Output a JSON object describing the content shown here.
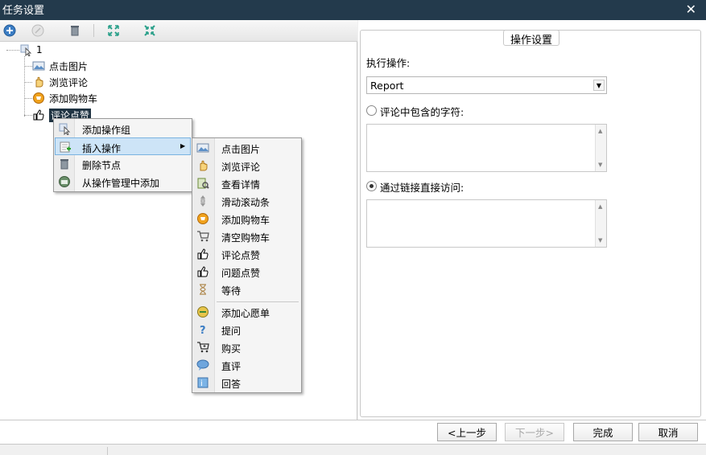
{
  "window": {
    "title": "任务设置",
    "close_glyph": "✕"
  },
  "toolbar": {
    "buttons": [
      {
        "icon": "add-circle-icon"
      },
      {
        "icon": "cancel-circle-icon"
      },
      {
        "icon": "trash-icon"
      },
      {
        "icon": "expand-icon"
      },
      {
        "icon": "collapse-icon"
      }
    ]
  },
  "tree": {
    "root": {
      "label": "1",
      "icon": "cursor-icon"
    },
    "children": [
      {
        "label": "点击图片",
        "icon": "image-icon"
      },
      {
        "label": "浏览评论",
        "icon": "hand-icon"
      },
      {
        "label": "添加购物车",
        "icon": "cart-add-icon"
      },
      {
        "label": "评论点赞",
        "icon": "thumb-up-icon",
        "selected": true
      }
    ]
  },
  "context_menu": {
    "items": [
      {
        "label": "添加操作组",
        "icon": "cursor-icon"
      },
      {
        "label": "插入操作",
        "icon": "insert-icon",
        "highlighted": true,
        "submenu_arrow": "▶"
      },
      {
        "label": "删除节点",
        "icon": "trash-icon"
      },
      {
        "label": "从操作管理中添加",
        "icon": "manage-icon"
      }
    ]
  },
  "submenu": {
    "items": [
      {
        "label": "点击图片",
        "icon": "image-icon"
      },
      {
        "label": "浏览评论",
        "icon": "hand-icon"
      },
      {
        "label": "查看详情",
        "icon": "details-icon"
      },
      {
        "label": "滑动滚动条",
        "icon": "scroll-icon"
      },
      {
        "label": "添加购物车",
        "icon": "cart-add-icon"
      },
      {
        "label": "清空购物车",
        "icon": "cart-empty-icon"
      },
      {
        "label": "评论点赞",
        "icon": "thumb-up-icon"
      },
      {
        "label": "问题点赞",
        "icon": "thumb-up-icon"
      },
      {
        "label": "等待",
        "icon": "hourglass-icon"
      },
      {
        "label": "添加心愿单",
        "icon": "wishlist-icon"
      },
      {
        "label": "提问",
        "icon": "question-icon"
      },
      {
        "label": "购买",
        "icon": "buy-cart-icon"
      },
      {
        "label": "直评",
        "icon": "comment-icon"
      },
      {
        "label": "回答",
        "icon": "answer-icon"
      }
    ]
  },
  "settings": {
    "group_title": "操作设置",
    "action_label": "执行操作:",
    "action_value": "Report",
    "option_contains": {
      "label": "评论中包含的字符:",
      "checked": false
    },
    "option_link": {
      "label": "通过链接直接访问:",
      "checked": true
    }
  },
  "buttons": {
    "prev": "<上一步",
    "next": "下一步>",
    "finish": "完成",
    "cancel": "取消"
  },
  "colors": {
    "titlebar": "#233a4c",
    "selection": "#1f3342",
    "menu_highlight": "#cde4f7"
  }
}
